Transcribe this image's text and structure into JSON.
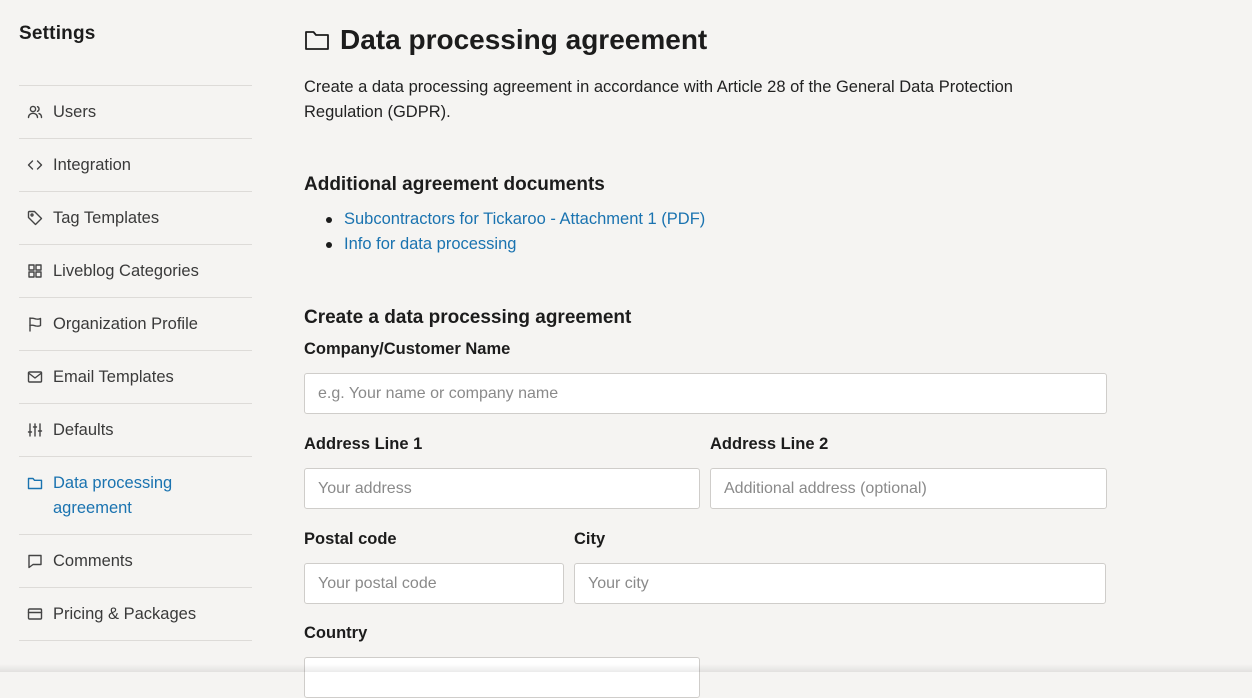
{
  "sidebar": {
    "title": "Settings",
    "items": [
      {
        "label": "Users",
        "icon": "users-icon"
      },
      {
        "label": "Integration",
        "icon": "code-icon"
      },
      {
        "label": "Tag Templates",
        "icon": "tag-icon"
      },
      {
        "label": "Liveblog Categories",
        "icon": "grid-icon"
      },
      {
        "label": "Organization Profile",
        "icon": "flag-icon"
      },
      {
        "label": "Email Templates",
        "icon": "mail-icon"
      },
      {
        "label": "Defaults",
        "icon": "sliders-icon"
      },
      {
        "label": "Data processing agreement",
        "icon": "folder-icon",
        "active": true
      },
      {
        "label": "Comments",
        "icon": "comment-icon"
      },
      {
        "label": "Pricing & Packages",
        "icon": "credit-card-icon"
      }
    ]
  },
  "main": {
    "title": "Data processing agreement",
    "title_icon": "folder-icon",
    "intro": "Create a data processing agreement in accordance with Article 28 of the General Data Protection Regulation (GDPR).",
    "additional_heading": "Additional agreement documents",
    "documents": [
      "Subcontractors for Tickaroo - Attachment 1 (PDF)",
      "Info for data processing"
    ],
    "create_heading": "Create a data processing agreement",
    "form": {
      "company": {
        "label": "Company/Customer Name",
        "placeholder": "e.g. Your name or company name"
      },
      "address1": {
        "label": "Address Line 1",
        "placeholder": "Your address"
      },
      "address2": {
        "label": "Address Line 2",
        "placeholder": "Additional address (optional)"
      },
      "postal": {
        "label": "Postal code",
        "placeholder": "Your postal code"
      },
      "city": {
        "label": "City",
        "placeholder": "Your city"
      },
      "country": {
        "label": "Country"
      }
    }
  },
  "colors": {
    "accent": "#1a73b0",
    "background": "#f5f4f2"
  }
}
